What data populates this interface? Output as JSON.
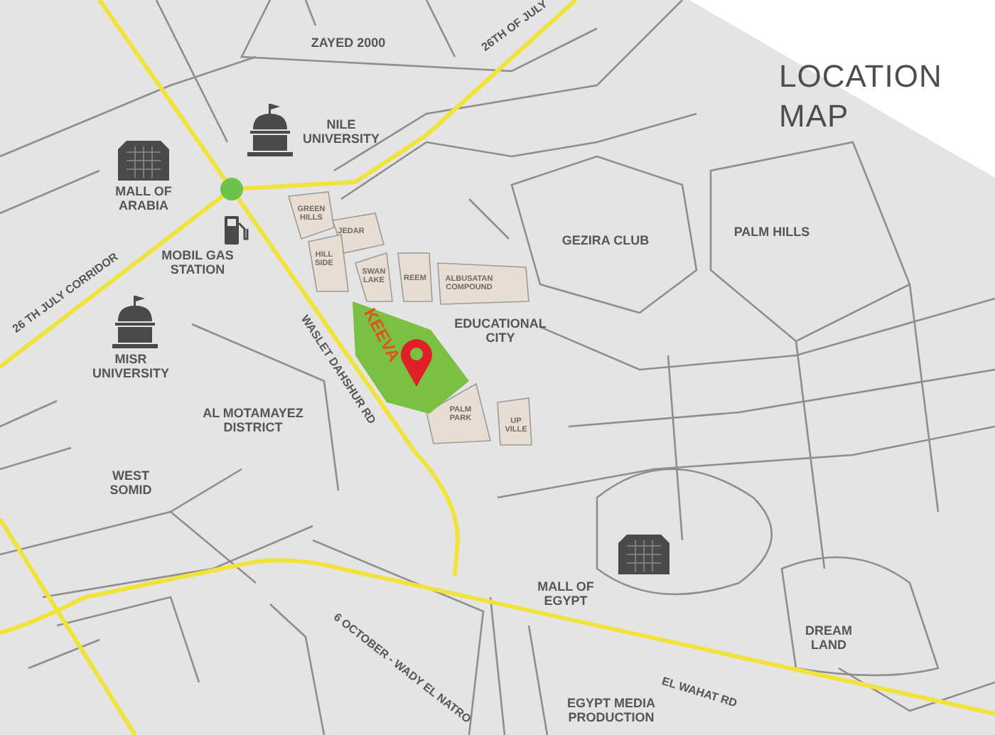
{
  "title": "LOCATION MAP",
  "labels": [
    {
      "text": "ZAYED 2000",
      "kind": "area"
    },
    {
      "text": "26TH OF JULY",
      "kind": "road"
    },
    {
      "text": "NILE UNIVERSITY",
      "kind": "area"
    },
    {
      "text": "MALL OF ARABIA",
      "kind": "area"
    },
    {
      "text": "MOBIL GAS STATION",
      "kind": "area"
    },
    {
      "text": "26 TH JULY CORRIDOR",
      "kind": "road"
    },
    {
      "text": "MISR UNIVERSITY",
      "kind": "area"
    },
    {
      "text": "GREEN HILLS",
      "kind": "plot"
    },
    {
      "text": "JEDAR",
      "kind": "plot"
    },
    {
      "text": "HILL SIDE",
      "kind": "plot"
    },
    {
      "text": "SWAN LAKE",
      "kind": "plot"
    },
    {
      "text": "REEM",
      "kind": "plot"
    },
    {
      "text": "ALBUSATAN COMPOUND",
      "kind": "plot"
    },
    {
      "text": "GEZIRA CLUB",
      "kind": "area"
    },
    {
      "text": "PALM HILLS",
      "kind": "area"
    },
    {
      "text": "KEEVA",
      "kind": "project"
    },
    {
      "text": "EDUCATIONAL CITY",
      "kind": "area"
    },
    {
      "text": "WASLET DAHSHUR RD",
      "kind": "road"
    },
    {
      "text": "AL MOTAMAYEZ DISTRICT",
      "kind": "area"
    },
    {
      "text": "PALM PARK",
      "kind": "plot"
    },
    {
      "text": "UP VILLE",
      "kind": "plot"
    },
    {
      "text": "WEST SOMID",
      "kind": "area"
    },
    {
      "text": "MALL OF EGYPT",
      "kind": "area"
    },
    {
      "text": "DREAM LAND",
      "kind": "area"
    },
    {
      "text": "6 OCTOBER - WADY EL NATRO",
      "kind": "road"
    },
    {
      "text": "EL WAHAT RD",
      "kind": "road"
    },
    {
      "text": "EGYPT MEDIA PRODUCTION",
      "kind": "area"
    }
  ]
}
